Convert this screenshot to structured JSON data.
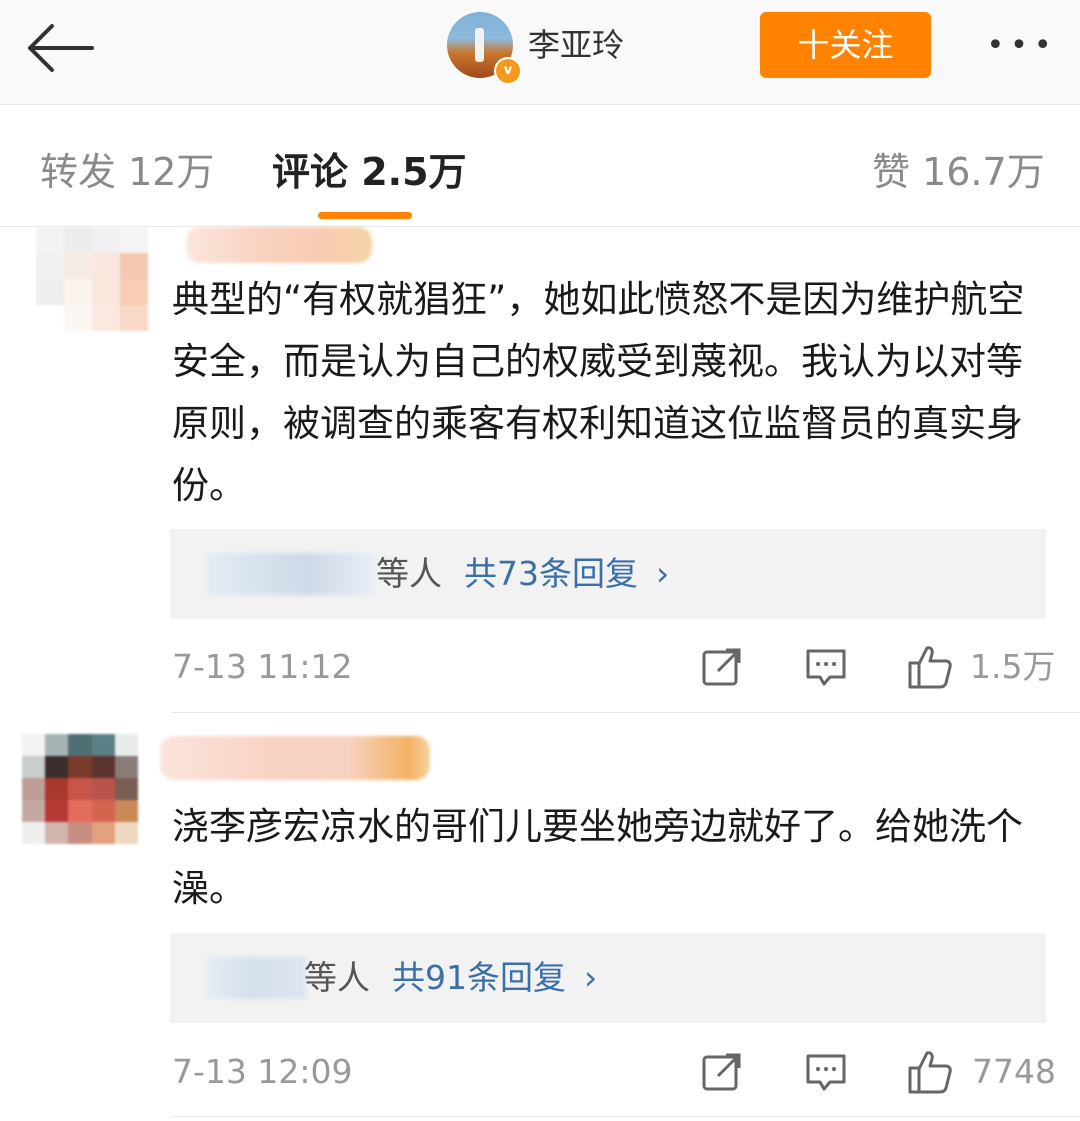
{
  "header": {
    "user_name": "李亚玲",
    "verified_badge": "v",
    "follow_label": "十关注",
    "more_label": "•••"
  },
  "tabs": {
    "repost": "转发 12万",
    "comments": "评论 2.5万",
    "likes": "赞 16.7万"
  },
  "comments": [
    {
      "text": "典型的“有权就猖狂”，她如此愤怒不是因为维护航空安全，而是认为自己的权威受到蔑视。我认为以对等原则，被调查的乘客有权利知道这位监督员的真实身份。",
      "reply_etc": "等人",
      "reply_count": "共73条回复",
      "time": "7-13 11:12",
      "likes": "1.5万"
    },
    {
      "text": "浇李彦宏凉水的哥们儿要坐她旁边就好了。给她洗个澡。",
      "reply_etc": "等人",
      "reply_count": "共91条回复",
      "time": "7-13 12:09",
      "likes": "7748"
    }
  ],
  "colors": {
    "accent": "#ff8200",
    "link": "#3a6fa8",
    "muted": "#999999"
  }
}
